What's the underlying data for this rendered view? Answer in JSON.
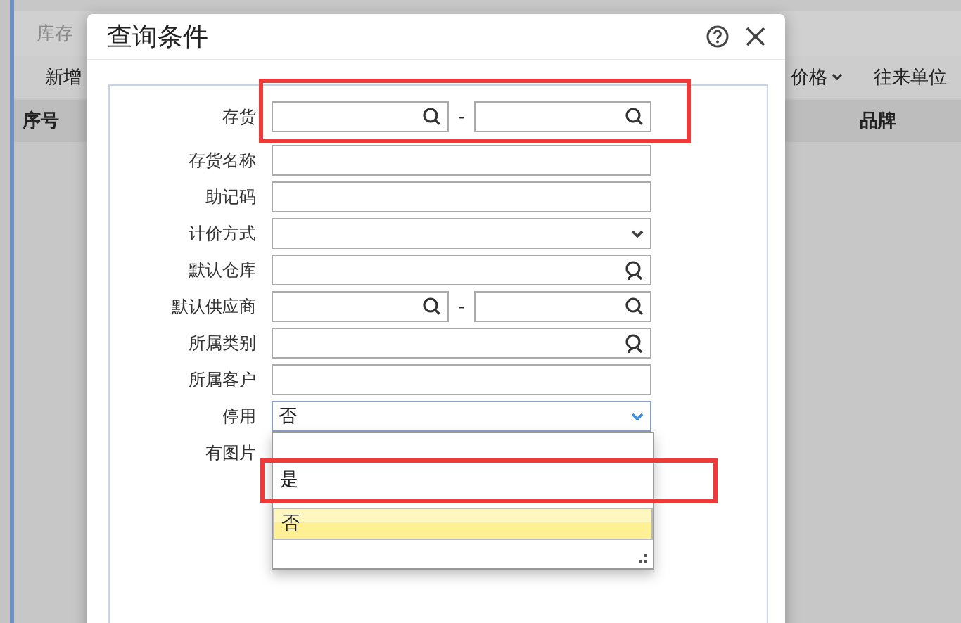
{
  "background": {
    "tab": "库存",
    "toolbar": [
      {
        "label": "新增",
        "dropdown": false
      },
      {
        "label": "价格",
        "dropdown": true
      },
      {
        "label": "往来单位",
        "dropdown": false
      }
    ],
    "columns": [
      "序号",
      "品牌"
    ]
  },
  "dialog": {
    "title": "查询条件",
    "fields": [
      {
        "label": "存货",
        "kind": "range",
        "separator": "-",
        "highlighted": true
      },
      {
        "label": "存货名称",
        "kind": "text",
        "highlighted": false
      },
      {
        "label": "助记码",
        "kind": "text",
        "highlighted": false
      },
      {
        "label": "计价方式",
        "kind": "select",
        "highlighted": false
      },
      {
        "label": "默认仓库",
        "kind": "lookup",
        "highlighted": false
      },
      {
        "label": "默认供应商",
        "kind": "range",
        "separator": "-",
        "highlighted": false
      },
      {
        "label": "所属类别",
        "kind": "lookup",
        "highlighted": false
      },
      {
        "label": "所属客户",
        "kind": "text",
        "highlighted": false
      },
      {
        "label": "停用",
        "kind": "select",
        "value": "否",
        "open": true,
        "highlighted": false
      },
      {
        "label": "有图片",
        "kind": "covered",
        "highlighted": false
      }
    ],
    "dropdown_options": [
      {
        "label": "是",
        "selected": false,
        "highlighted": true
      },
      {
        "label": "否",
        "selected": true,
        "highlighted": false
      }
    ]
  }
}
